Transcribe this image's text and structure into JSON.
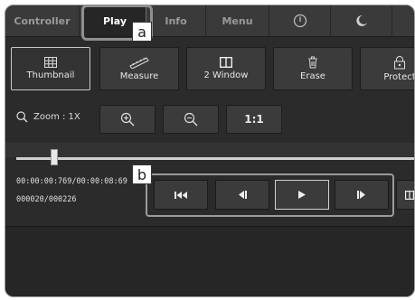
{
  "tabs": [
    {
      "label": "Controller",
      "active": false
    },
    {
      "label": "Play",
      "active": true
    },
    {
      "label": "Info",
      "active": false
    },
    {
      "label": "Menu",
      "active": false
    },
    {
      "icon": "power-icon",
      "active": false
    },
    {
      "icon": "moon-icon",
      "active": false
    }
  ],
  "toolbar": {
    "thumbnail": "Thumbnail",
    "measure": "Measure",
    "window": "2 Window",
    "erase": "Erase",
    "protect": "Protect"
  },
  "zoom": {
    "label": "Zoom : 1X",
    "ratio_label": "1:1"
  },
  "playback": {
    "timecode": "00:00:00:769/00:00:08:69",
    "frames": "000020/000226"
  },
  "callouts": {
    "a": "a",
    "b": "b"
  },
  "colors": {
    "panel": "#2b2b2b",
    "button": "#3b3b3b",
    "highlight_outline": "#9b9b9b"
  }
}
